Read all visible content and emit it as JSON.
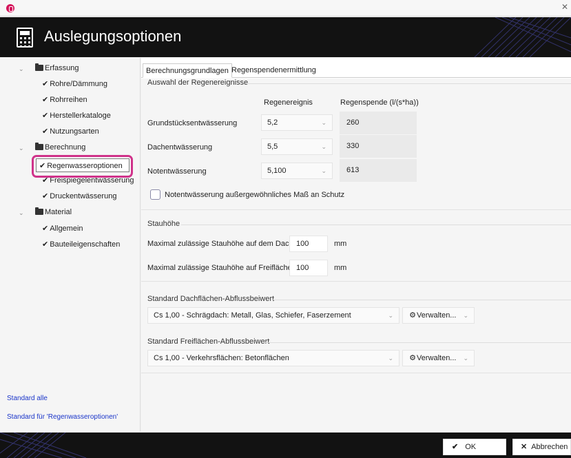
{
  "window": {
    "close_glyph": "✕"
  },
  "header": {
    "title": "Auslegungsoptionen",
    "icon": "calculator-icon"
  },
  "sidebar": {
    "tree": [
      {
        "label": "Erfassung",
        "type": "folder",
        "expanded": true
      },
      {
        "label": "Rohre/Dämmung",
        "type": "check"
      },
      {
        "label": "Rohrreihen",
        "type": "check"
      },
      {
        "label": "Herstellerkataloge",
        "type": "check"
      },
      {
        "label": "Nutzungsarten",
        "type": "check"
      },
      {
        "label": "Berechnung",
        "type": "folder",
        "expanded": true
      },
      {
        "label": "Regenwasseroptionen",
        "type": "check",
        "selected": true
      },
      {
        "label": "Freispiegelentwässerung",
        "type": "check"
      },
      {
        "label": "Druckentwässerung",
        "type": "check"
      },
      {
        "label": "Material",
        "type": "folder",
        "expanded": true
      },
      {
        "label": "Allgemein",
        "type": "check"
      },
      {
        "label": "Bauteileigenschaften",
        "type": "check"
      }
    ],
    "links": {
      "reset_all": "Standard alle",
      "reset_current": "Standard für 'Regenwasseroptionen'"
    }
  },
  "tabs": [
    {
      "label": "Berechnungsgrundlagen",
      "active": true
    },
    {
      "label": "Regenspendenermittlung",
      "active": false
    }
  ],
  "rain_events": {
    "title": "Auswahl der Regenereignisse",
    "col_event": "Regenereignis",
    "col_yield": "Regenspende (l/(s*ha))",
    "rows": [
      {
        "label": "Grundstücksentwässerung",
        "event": "5,2",
        "yield": "260"
      },
      {
        "label": "Dachentwässerung",
        "event": "5,5",
        "yield": "330"
      },
      {
        "label": "Notentwässerung",
        "event": "5,100",
        "yield": "613"
      }
    ],
    "checkbox_label": "Notentwässerung außergewöhnliches Maß an Schutz",
    "checkbox_checked": false
  },
  "stauhoehe": {
    "title": "Stauhöhe",
    "roof_label": "Maximal zulässige Stauhöhe auf dem Dach",
    "roof_value": "100",
    "free_label": "Maximal zulässige Stauhöhe auf Freiflächen",
    "free_value": "100",
    "unit": "mm"
  },
  "roof_coeff": {
    "title": "Standard Dachflächen-Abflussbeiwert",
    "value": "Cs 1,00 - Schrägdach: Metall, Glas, Schiefer, Faserzement",
    "manage_label": "Verwalten..."
  },
  "free_coeff": {
    "title": "Standard Freiflächen-Abflussbeiwert",
    "value": "Cs 1,00 - Verkehrsflächen: Betonflächen",
    "manage_label": "Verwalten..."
  },
  "footer": {
    "ok_label": "OK",
    "cancel_label": "Abbrechen"
  },
  "colors": {
    "header_bg": "#121212",
    "selection_ring": "#d0338b",
    "link": "#1a35c9"
  }
}
